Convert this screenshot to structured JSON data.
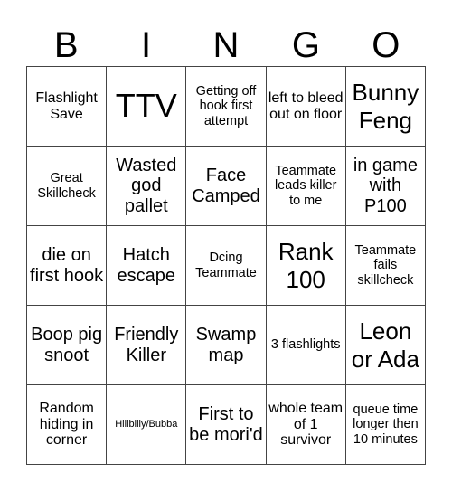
{
  "header": {
    "letters": [
      "B",
      "I",
      "N",
      "G",
      "O"
    ]
  },
  "board": {
    "rows": [
      [
        "Flashlight Save",
        "TTV",
        "Getting off hook first attempt",
        "left to bleed out on floor",
        "Bunny Feng"
      ],
      [
        "Great Skillcheck",
        "Wasted god pallet",
        "Face Camped",
        "Teammate leads killer to me",
        "in game with P100"
      ],
      [
        "die on first hook",
        "Hatch escape",
        "Dcing Teammate",
        "Rank 100",
        "Teammate fails skillcheck"
      ],
      [
        "Boop pig snoot",
        "Friendly Killer",
        "Swamp map",
        "3 flashlights",
        "Leon or Ada"
      ],
      [
        "Random hiding in corner",
        "Hillbilly/Bubba",
        "First to be mori'd",
        "whole team of 1 survivor",
        "queue time longer then 10 minutes"
      ]
    ]
  }
}
